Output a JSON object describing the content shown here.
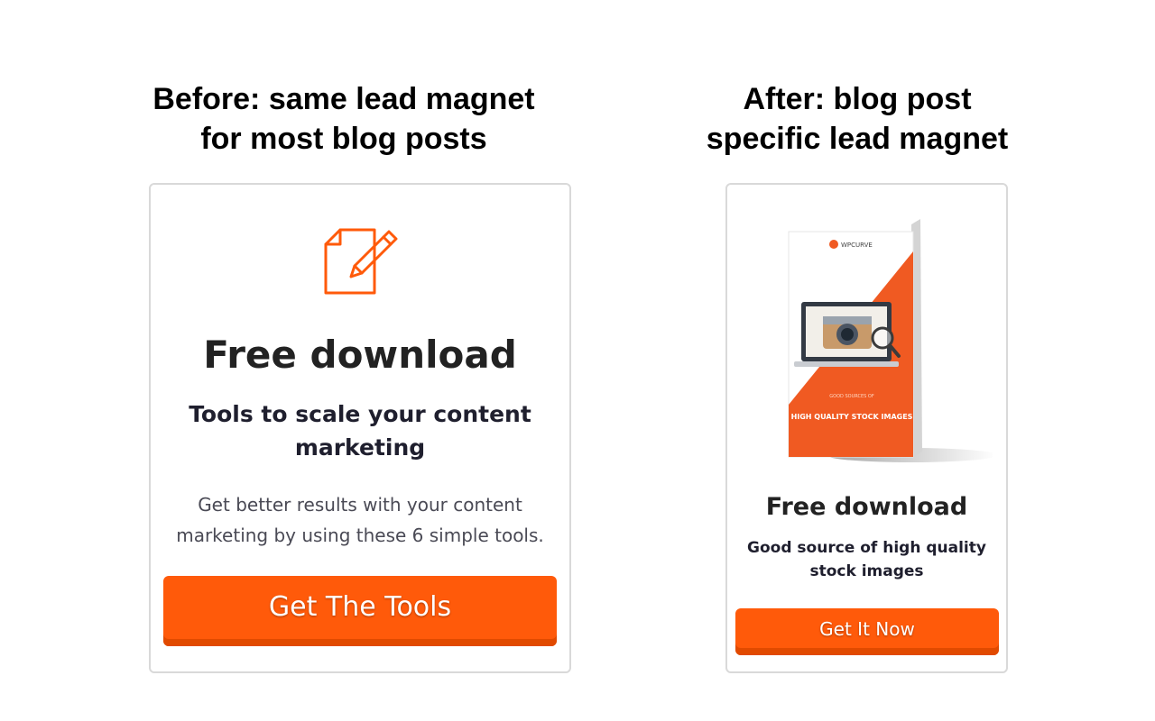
{
  "before": {
    "heading_line1": "Before: same lead magnet",
    "heading_line2": "for most blog posts",
    "card_title": "Free download",
    "card_subtitle": "Tools to scale your content marketing",
    "card_description": "Get better results with your content marketing by using these 6 simple tools.",
    "button_label": "Get The Tools",
    "icon": "document-edit-icon"
  },
  "after": {
    "heading_line1": "After: blog post",
    "heading_line2": "specific lead magnet",
    "card_title": "Free download",
    "card_subtitle": "Good source of high quality stock images",
    "button_label": "Get It Now",
    "ebook": {
      "brand": "WPCURVE",
      "kicker": "GOOD SOURCES OF",
      "title": "HIGH QUALITY STOCK IMAGES"
    }
  },
  "colors": {
    "accent": "#ff5a0a",
    "accent_dark": "#e14a00",
    "border": "#d9d9d9",
    "heading": "#000000"
  }
}
